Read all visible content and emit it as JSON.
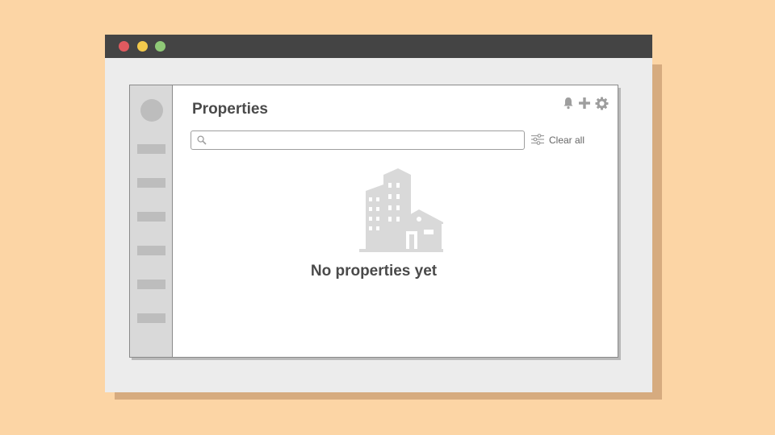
{
  "window": {
    "controls": [
      "close",
      "minimize",
      "maximize"
    ]
  },
  "sidebar": {
    "items": [
      "",
      "",
      "",
      "",
      "",
      ""
    ]
  },
  "header": {
    "title": "Properties",
    "icons": [
      "bell-icon",
      "plus-icon",
      "gear-icon"
    ]
  },
  "search": {
    "value": "",
    "placeholder": ""
  },
  "filters": {
    "clear_label": "Clear all"
  },
  "empty_state": {
    "icon": "buildings-icon",
    "message": "No properties yet"
  },
  "colors": {
    "background": "#fcd5a5",
    "titlebar": "#444444",
    "text": "#4a4a4a",
    "icon": "#9e9e9e"
  }
}
